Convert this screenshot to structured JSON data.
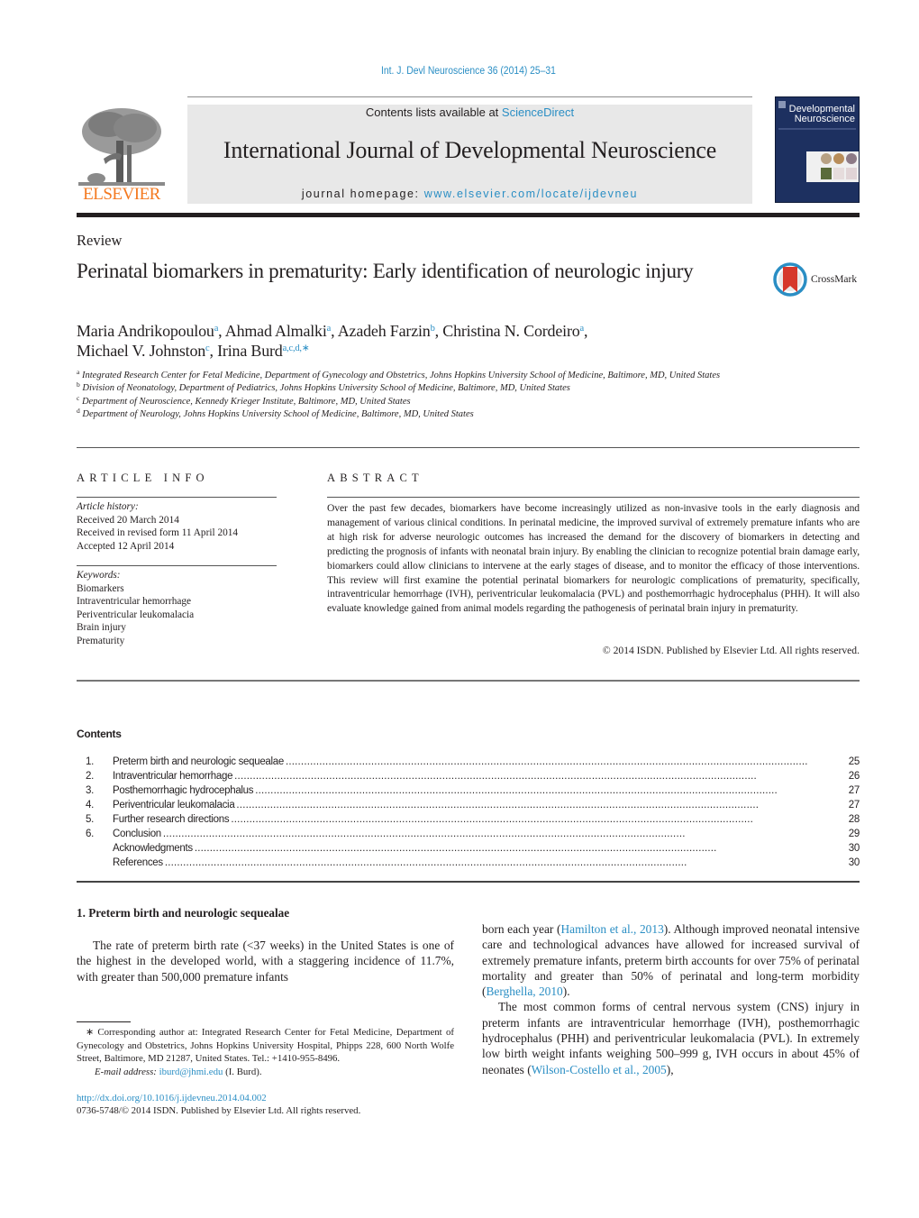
{
  "header": {
    "citation": "Int. J. Devl Neuroscience 36 (2014) 25–31",
    "publisher_logo_text": "ELSEVIER",
    "contents_available_prefix": "Contents lists available at ",
    "contents_available_link": "ScienceDirect",
    "journal_title": "International Journal of Developmental Neuroscience",
    "homepage_prefix": "journal homepage: ",
    "homepage_link": "www.elsevier.com/locate/ijdevneu",
    "cover_title_line1": "Developmental",
    "cover_title_line2": "Neuroscience"
  },
  "article": {
    "type": "Review",
    "title": "Perinatal biomarkers in prematurity: Early identification of neurologic injury",
    "crossmark_label": "CrossMark",
    "authors": [
      {
        "name": "Maria Andrikopoulou",
        "sup": "a"
      },
      {
        "name": "Ahmad Almalki",
        "sup": "a"
      },
      {
        "name": "Azadeh Farzin",
        "sup": "b"
      },
      {
        "name": "Christina N. Cordeiro",
        "sup": "a"
      },
      {
        "name": "Michael V. Johnston",
        "sup": "c"
      },
      {
        "name": "Irina Burd",
        "sup": "a,c,d,∗"
      }
    ],
    "affiliations": [
      {
        "key": "a",
        "text": "Integrated Research Center for Fetal Medicine, Department of Gynecology and Obstetrics, Johns Hopkins University School of Medicine, Baltimore, MD, United States"
      },
      {
        "key": "b",
        "text": "Division of Neonatology, Department of Pediatrics, Johns Hopkins University School of Medicine, Baltimore, MD, United States"
      },
      {
        "key": "c",
        "text": "Department of Neuroscience, Kennedy Krieger Institute, Baltimore, MD, United States"
      },
      {
        "key": "d",
        "text": "Department of Neurology, Johns Hopkins University School of Medicine, Baltimore, MD, United States"
      }
    ]
  },
  "article_info": {
    "label": "ARTICLE INFO",
    "history_label": "Article history:",
    "history": [
      "Received 20 March 2014",
      "Received in revised form 11 April 2014",
      "Accepted 12 April 2014"
    ],
    "keywords_label": "Keywords:",
    "keywords": [
      "Biomarkers",
      "Intraventricular hemorrhage",
      "Periventricular leukomalacia",
      "Brain injury",
      "Prematurity"
    ]
  },
  "abstract": {
    "label": "ABSTRACT",
    "text": "Over the past few decades, biomarkers have become increasingly utilized as non-invasive tools in the early diagnosis and management of various clinical conditions. In perinatal medicine, the improved survival of extremely premature infants who are at high risk for adverse neurologic outcomes has increased the demand for the discovery of biomarkers in detecting and predicting the prognosis of infants with neonatal brain injury. By enabling the clinician to recognize potential brain damage early, biomarkers could allow clinicians to intervene at the early stages of disease, and to monitor the efficacy of those interventions. This review will first examine the potential perinatal biomarkers for neurologic complications of prematurity, specifically, intraventricular hemorrhage (IVH), periventricular leukomalacia (PVL) and posthemorrhagic hydrocephalus (PHH). It will also evaluate knowledge gained from animal models regarding the pathogenesis of perinatal brain injury in prematurity.",
    "copyright": "© 2014 ISDN. Published by Elsevier Ltd. All rights reserved."
  },
  "contents": {
    "heading": "Contents",
    "items": [
      {
        "num": "1.",
        "title": "Preterm birth and neurologic sequealae",
        "page": "25"
      },
      {
        "num": "2.",
        "title": "Intraventricular hemorrhage",
        "page": "26"
      },
      {
        "num": "3.",
        "title": "Posthemorrhagic hydrocephalus",
        "page": "27"
      },
      {
        "num": "4.",
        "title": "Periventricular leukomalacia",
        "page": "27"
      },
      {
        "num": "5.",
        "title": "Further research directions",
        "page": "28"
      },
      {
        "num": "6.",
        "title": "Conclusion",
        "page": "29"
      },
      {
        "num": "",
        "title": "Acknowledgments",
        "page": "30"
      },
      {
        "num": "",
        "title": "References",
        "page": "30"
      }
    ]
  },
  "body": {
    "section1_heading": "1.  Preterm birth and neurologic sequealae",
    "left_para": "The rate of preterm birth rate (<37 weeks) in the United States is one of the highest in the developed world, with a staggering incidence of 11.7%, with greater than 500,000 premature infants",
    "right_para1_a": "born each year (",
    "right_para1_cite1": "Hamilton et al., 2013",
    "right_para1_b": "). Although improved neonatal intensive care and technological advances have allowed for increased survival of extremely premature infants, preterm birth accounts for over 75% of perinatal mortality and greater than 50% of perinatal and long-term morbidity (",
    "right_para1_cite2": "Berghella, 2010",
    "right_para1_c": ").",
    "right_para2_a": "The most common forms of central nervous system (CNS) injury in preterm infants are intraventricular hemorrhage (IVH), posthemorrhagic hydrocephalus (PHH) and periventricular leukomalacia (PVL). In extremely low birth weight infants weighing 500–999 g, IVH occurs in about 45% of neonates (",
    "right_para2_cite": "Wilson-Costello et al., 2005",
    "right_para2_b": "),"
  },
  "footnote": {
    "text": "∗ Corresponding author at: Integrated Research Center for Fetal Medicine, Department of Gynecology and Obstetrics, Johns Hopkins University Hospital, Phipps 228, 600 North Wolfe Street, Baltimore, MD 21287, United States. Tel.: +1410-955-8496.",
    "email_label": "E-mail address: ",
    "email": "iburd@jhmi.edu",
    "email_suffix": " (I. Burd).",
    "doi": "http://dx.doi.org/10.1016/j.ijdevneu.2014.04.002",
    "issn": "0736-5748/© 2014 ISDN. Published by Elsevier Ltd. All rights reserved."
  },
  "colors": {
    "link": "#2a8ec4",
    "elsevier_orange": "#f47920",
    "header_band": "#e8e8e8",
    "cover_blue": "#1d3060",
    "crossmark_red": "#d6382b",
    "crossmark_ring": "#2a8ec4"
  }
}
